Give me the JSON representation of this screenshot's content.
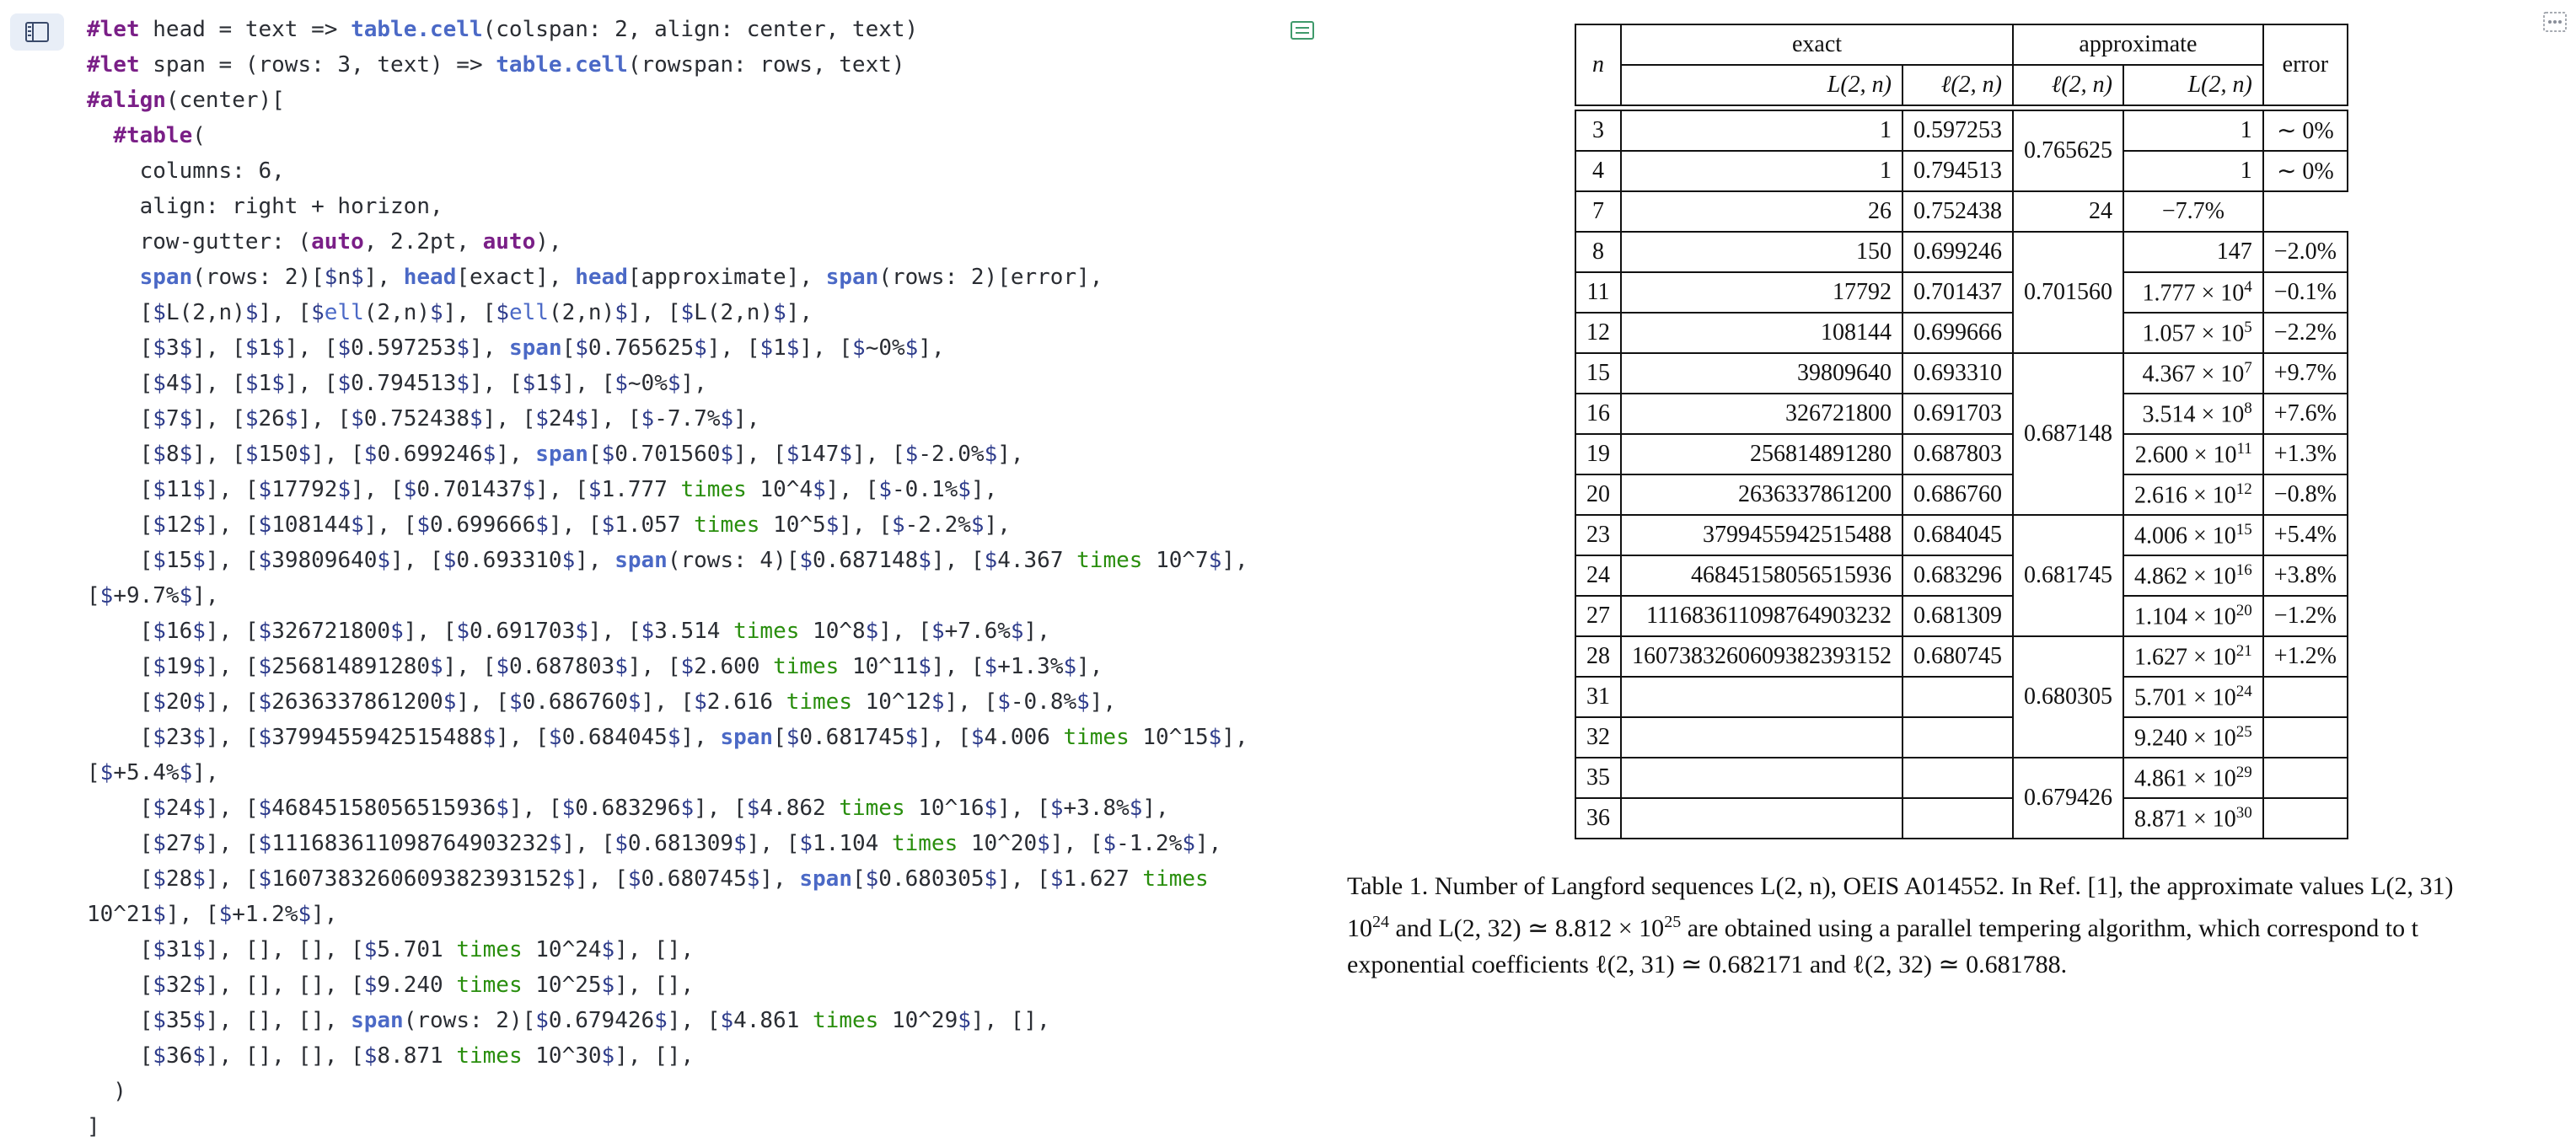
{
  "editor": {
    "lines": [
      "#let head = text => table.cell(colspan: 2, align: center, text)",
      "#let span = (rows: 3, text) => table.cell(rowspan: rows, text)",
      "#align(center)[",
      "  #table(",
      "    columns: 6,",
      "    align: right + horizon,",
      "    row-gutter: (auto, 2.2pt, auto),",
      "    span(rows: 2)[$n$], head[exact], head[approximate], span(rows: 2)[error],",
      "    [$L(2,n)$], [$ell(2,n)$], [$ell(2,n)$], [$L(2,n)$],",
      "    [$3$], [$1$], [$0.597253$], span[$0.765625$], [$1$], [$~0%$],",
      "    [$4$], [$1$], [$0.794513$], [$1$], [$~0%$],",
      "    [$7$], [$26$], [$0.752438$], [$24$], [$-7.7%$],",
      "    [$8$], [$150$], [$0.699246$], span[$0.701560$], [$147$], [$-2.0%$],",
      "    [$11$], [$17792$], [$0.701437$], [$1.777 times 10^4$], [$-0.1%$],",
      "    [$12$], [$108144$], [$0.699666$], [$1.057 times 10^5$], [$-2.2%$],",
      "    [$15$], [$39809640$], [$0.693310$], span(rows: 4)[$0.687148$], [$4.367 times 10^7$],",
      "[$+9.7%$],",
      "    [$16$], [$326721800$], [$0.691703$], [$3.514 times 10^8$], [$+7.6%$],",
      "    [$19$], [$256814891280$], [$0.687803$], [$2.600 times 10^11$], [$+1.3%$],",
      "    [$20$], [$2636337861200$], [$0.686760$], [$2.616 times 10^12$], [$-0.8%$],",
      "    [$23$], [$3799455942515488$], [$0.684045$], span[$0.681745$], [$4.006 times 10^15$],",
      "[$+5.4%$],",
      "    [$24$], [$46845158056515936$], [$0.683296$], [$4.862 times 10^16$], [$+3.8%$],",
      "    [$27$], [$111683611098764903232$], [$0.681309$], [$1.104 times 10^20$], [$-1.2%$],",
      "    [$28$], [$1607383260609382393152$], [$0.680745$], span[$0.680305$], [$1.627 times",
      "10^21$], [$+1.2%$],",
      "    [$31$], [], [], [$5.701 times 10^24$], [],",
      "    [$32$], [], [], [$9.240 times 10^25$], [],",
      "    [$35$], [], [], span(rows: 2)[$0.679426$], [$4.861 times 10^29$], [],",
      "    [$36$], [], [], [$8.871 times 10^30$], [],",
      "  )",
      "]"
    ]
  },
  "table": {
    "head_n": "n",
    "head_exact": "exact",
    "head_approximate": "approximate",
    "head_error": "error",
    "sub_L_exact": "L(2, n)",
    "sub_ell_exact": "ℓ(2, n)",
    "sub_ell_approx": "ℓ(2, n)",
    "sub_L_approx": "L(2, n)",
    "rows": [
      {
        "n": "3",
        "L": "1",
        "ell": "0.597253",
        "L_approx": "1",
        "err": "∼ 0%"
      },
      {
        "n": "4",
        "L": "1",
        "ell": "0.794513",
        "L_approx": "1",
        "err": "∼ 0%"
      },
      {
        "n": "7",
        "L": "26",
        "ell": "0.752438",
        "L_approx": "24",
        "err": "−7.7%"
      },
      {
        "n": "8",
        "L": "150",
        "ell": "0.699246",
        "L_approx": "147",
        "err": "−2.0%"
      },
      {
        "n": "11",
        "L": "17792",
        "ell": "0.701437",
        "L_approx": "1.777 × 10",
        "L_exp": "4",
        "err": "−0.1%"
      },
      {
        "n": "12",
        "L": "108144",
        "ell": "0.699666",
        "L_approx": "1.057 × 10",
        "L_exp": "5",
        "err": "−2.2%"
      },
      {
        "n": "15",
        "L": "39809640",
        "ell": "0.693310",
        "L_approx": "4.367 × 10",
        "L_exp": "7",
        "err": "+9.7%"
      },
      {
        "n": "16",
        "L": "326721800",
        "ell": "0.691703",
        "L_approx": "3.514 × 10",
        "L_exp": "8",
        "err": "+7.6%"
      },
      {
        "n": "19",
        "L": "256814891280",
        "ell": "0.687803",
        "L_approx": "2.600 × 10",
        "L_exp": "11",
        "err": "+1.3%"
      },
      {
        "n": "20",
        "L": "2636337861200",
        "ell": "0.686760",
        "L_approx": "2.616 × 10",
        "L_exp": "12",
        "err": "−0.8%"
      },
      {
        "n": "23",
        "L": "3799455942515488",
        "ell": "0.684045",
        "L_approx": "4.006 × 10",
        "L_exp": "15",
        "err": "+5.4%"
      },
      {
        "n": "24",
        "L": "46845158056515936",
        "ell": "0.683296",
        "L_approx": "4.862 × 10",
        "L_exp": "16",
        "err": "+3.8%"
      },
      {
        "n": "27",
        "L": "111683611098764903232",
        "ell": "0.681309",
        "L_approx": "1.104 × 10",
        "L_exp": "20",
        "err": "−1.2%"
      },
      {
        "n": "28",
        "L": "1607383260609382393152",
        "ell": "0.680745",
        "L_approx": "1.627 × 10",
        "L_exp": "21",
        "err": "+1.2%"
      },
      {
        "n": "31",
        "L": "",
        "ell": "",
        "L_approx": "5.701 × 10",
        "L_exp": "24",
        "err": ""
      },
      {
        "n": "32",
        "L": "",
        "ell": "",
        "L_approx": "9.240 × 10",
        "L_exp": "25",
        "err": ""
      },
      {
        "n": "35",
        "L": "",
        "ell": "",
        "L_approx": "4.861 × 10",
        "L_exp": "29",
        "err": ""
      },
      {
        "n": "36",
        "L": "",
        "ell": "",
        "L_approx": "8.871 × 10",
        "L_exp": "30",
        "err": ""
      }
    ],
    "span_values": [
      "0.765625",
      "0.701560",
      "0.687148",
      "0.681745",
      "0.680305",
      "0.679426"
    ]
  },
  "caption": {
    "line1": "Table 1. Number of Langford sequences L(2, n), OEIS A014552. In Ref. [1], the approximate values L(2, 31)",
    "line2_pre": "10",
    "line2_exp": "24",
    "line2_mid": " and L(2, 32) ≃ 8.812 × 10",
    "line2_exp2": "25",
    "line2_post": " are obtained using a parallel tempering algorithm, which correspond to t",
    "line3": "exponential coefficients ℓ(2, 31) ≃ 0.682171 and ℓ(2, 32) ≃ 0.681788."
  },
  "icons": {
    "outline": "outline-toggle-icon",
    "preview": "preview-sync-icon",
    "menu": "more-menu-icon"
  },
  "colors": {
    "keyword": "#7a1f87",
    "function": "#4b69c6",
    "math": "#298e0d",
    "outline_bg": "#e8eef7"
  }
}
